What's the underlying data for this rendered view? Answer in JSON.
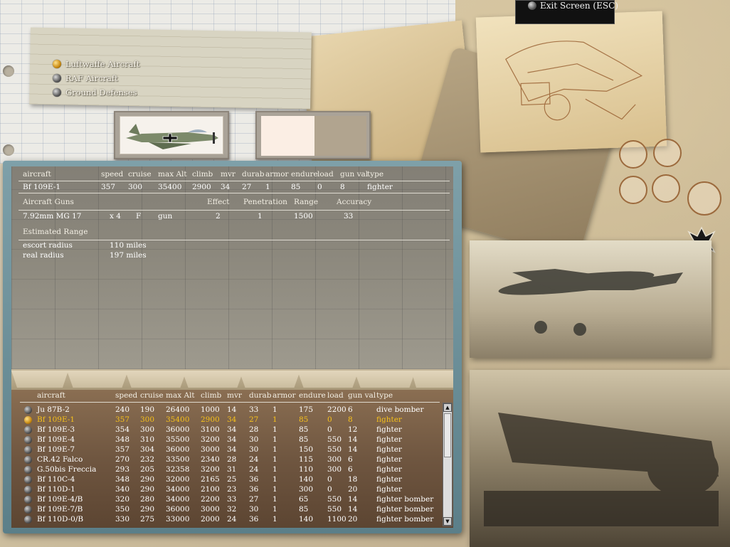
{
  "header": {
    "exit_label": "Exit Screen (ESC)"
  },
  "categories": [
    {
      "label": "Luftwaffe Aircraft",
      "selected": true
    },
    {
      "label": "RAF Aircraft",
      "selected": false
    },
    {
      "label": "Ground Defenses",
      "selected": false
    }
  ],
  "stats": {
    "columns": [
      "aircraft",
      "speed",
      "cruise",
      "max Alt",
      "climb",
      "mvr",
      "durab",
      "armor",
      "endure",
      "load",
      "gun val",
      "type"
    ],
    "selected": [
      "Bf 109E-1",
      "357",
      "300",
      "35400",
      "2900",
      "34",
      "27",
      "1",
      "85",
      "0",
      "8",
      "fighter"
    ]
  },
  "guns": {
    "columns": [
      "Aircraft Guns",
      "Effect",
      "Penetration",
      "Range",
      "Accuracy"
    ],
    "rows": [
      {
        "name": "7.92mm MG 17",
        "count": "x 4",
        "position": "F",
        "kind": "gun",
        "effect": "2",
        "penetration": "1",
        "range": "1500",
        "accuracy": "33"
      }
    ]
  },
  "range": {
    "title": "Estimated Range",
    "rows": [
      {
        "label": "escort radius",
        "value": "110 miles"
      },
      {
        "label": "real radius",
        "value": "197 miles"
      }
    ]
  },
  "aircraft_list": {
    "columns": [
      "aircraft",
      "speed",
      "cruise",
      "max Alt",
      "climb",
      "mvr",
      "durab",
      "armor",
      "endure",
      "load",
      "gun val",
      "type"
    ],
    "rows": [
      [
        "Ju 87B-2",
        "240",
        "190",
        "26400",
        "1000",
        "14",
        "33",
        "1",
        "175",
        "2200",
        "6",
        "dive bomber"
      ],
      [
        "Bf 109E-1",
        "357",
        "300",
        "35400",
        "2900",
        "34",
        "27",
        "1",
        "85",
        "0",
        "8",
        "fighter"
      ],
      [
        "Bf 109E-3",
        "354",
        "300",
        "36000",
        "3100",
        "34",
        "28",
        "1",
        "85",
        "0",
        "12",
        "fighter"
      ],
      [
        "Bf 109E-4",
        "348",
        "310",
        "35500",
        "3200",
        "34",
        "30",
        "1",
        "85",
        "550",
        "14",
        "fighter"
      ],
      [
        "Bf 109E-7",
        "357",
        "304",
        "36000",
        "3000",
        "34",
        "30",
        "1",
        "150",
        "550",
        "14",
        "fighter"
      ],
      [
        "CR.42 Falco",
        "270",
        "232",
        "33500",
        "2340",
        "28",
        "24",
        "1",
        "115",
        "300",
        "6",
        "fighter"
      ],
      [
        "G.50bis Freccia",
        "293",
        "205",
        "32358",
        "3200",
        "31",
        "24",
        "1",
        "110",
        "300",
        "6",
        "fighter"
      ],
      [
        "Bf 110C-4",
        "348",
        "290",
        "32000",
        "2165",
        "25",
        "36",
        "1",
        "140",
        "0",
        "18",
        "fighter"
      ],
      [
        "Bf 110D-1",
        "340",
        "290",
        "34000",
        "2100",
        "23",
        "36",
        "1",
        "300",
        "0",
        "20",
        "fighter"
      ],
      [
        "Bf 109E-4/B",
        "320",
        "280",
        "34000",
        "2200",
        "33",
        "27",
        "1",
        "65",
        "550",
        "14",
        "fighter bomber"
      ],
      [
        "Bf 109E-7/B",
        "350",
        "290",
        "36000",
        "3000",
        "32",
        "30",
        "1",
        "85",
        "550",
        "14",
        "fighter bomber"
      ],
      [
        "Bf 110D-0/B",
        "330",
        "275",
        "33000",
        "2000",
        "24",
        "36",
        "1",
        "140",
        "1100",
        "20",
        "fighter bomber"
      ]
    ],
    "selected_index": 1
  },
  "colors": {
    "panel_frame": "#6e929c",
    "selected_text": "#f7c21b"
  }
}
